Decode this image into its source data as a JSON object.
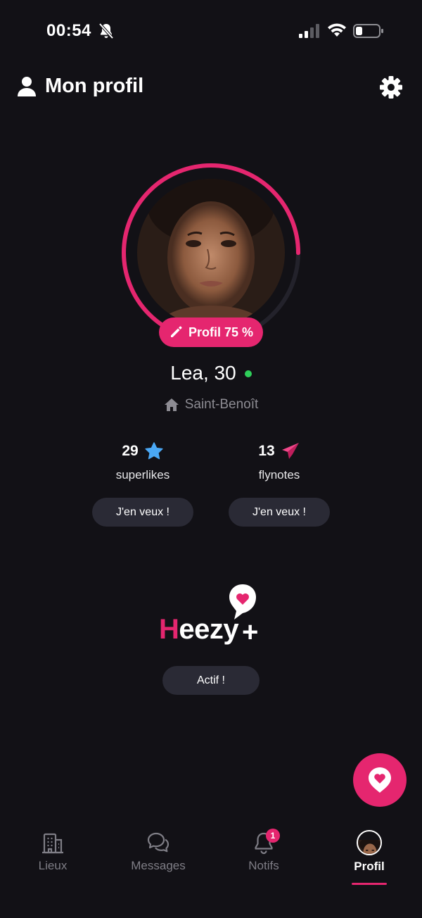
{
  "status_bar": {
    "time": "00:54"
  },
  "header": {
    "title": "Mon profil"
  },
  "profile": {
    "completion_label": "Profil 75 %",
    "completion_fraction": 0.75,
    "name_age": "Lea, 30",
    "online": true,
    "location": "Saint-Benoît"
  },
  "stats": {
    "superlikes": {
      "count": "29",
      "label": "superlikes",
      "button": "J'en veux !"
    },
    "flynotes": {
      "count": "13",
      "label": "flynotes",
      "button": "J'en veux !"
    }
  },
  "premium": {
    "logo_text": "Heezy+",
    "status_button": "Actif !"
  },
  "bottom_nav": {
    "items": [
      {
        "label": "Lieux"
      },
      {
        "label": "Messages"
      },
      {
        "label": "Notifs",
        "badge": "1"
      },
      {
        "label": "Profil",
        "active": true
      }
    ]
  },
  "colors": {
    "background": "#121116",
    "accent": "#e5266f",
    "button_bg": "#2a2a35",
    "online": "#2fcf5a",
    "star": "#4aa8f5",
    "muted_text": "#8d8c93"
  },
  "icons": {
    "status": [
      "bell-muted-icon",
      "signal-icon",
      "wifi-icon",
      "battery-icon"
    ],
    "header": [
      "user-icon",
      "gear-icon"
    ],
    "profile": [
      "pencil-icon",
      "home-icon"
    ],
    "stats": [
      "star-icon",
      "paper-plane-icon"
    ],
    "fab": "map-pin-heart-icon",
    "nav": [
      "building-icon",
      "chat-bubbles-icon",
      "bell-icon",
      "avatar"
    ]
  }
}
